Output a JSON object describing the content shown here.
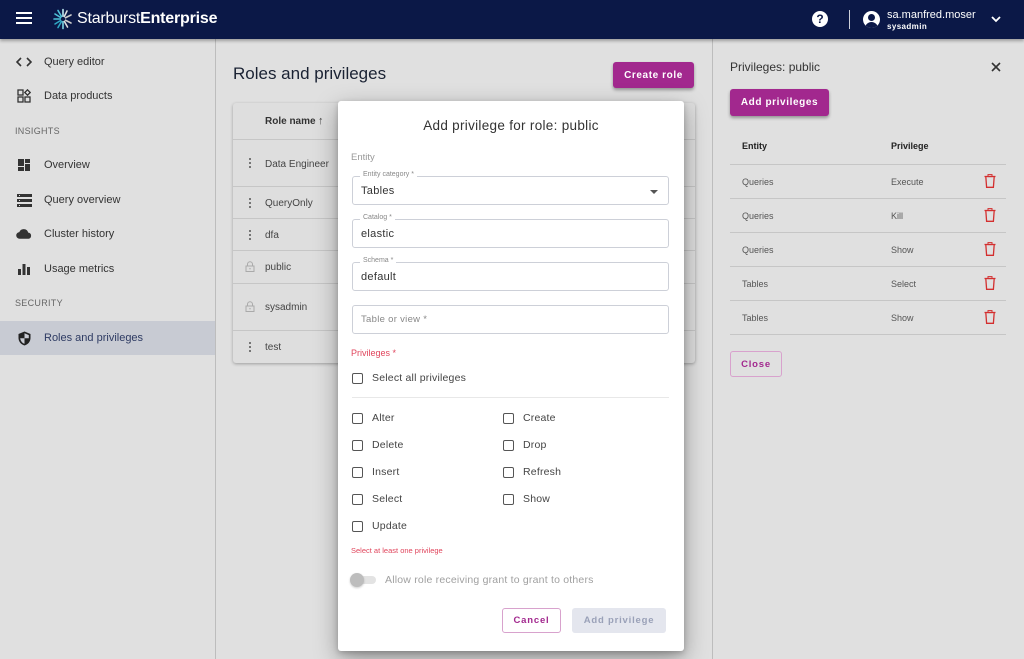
{
  "header": {
    "brand_light": "Starburst",
    "brand_bold": "Enterprise",
    "help_label": "?",
    "user_name": "sa.manfred.moser",
    "user_role": "sysadmin"
  },
  "sidebar": {
    "items": [
      {
        "label": "Query editor",
        "icon": "code-icon"
      },
      {
        "label": "Data products",
        "icon": "data-products-icon"
      },
      {
        "section": "INSIGHTS"
      },
      {
        "label": "Overview",
        "icon": "dashboard-icon"
      },
      {
        "label": "Query overview",
        "icon": "list-icon"
      },
      {
        "label": "Cluster history",
        "icon": "cloud-icon"
      },
      {
        "label": "Usage metrics",
        "icon": "bar-chart-icon"
      },
      {
        "section": "SECURITY"
      },
      {
        "label": "Roles and privileges",
        "icon": "shield-icon",
        "active": true
      }
    ]
  },
  "main": {
    "title": "Roles and privileges",
    "create_role_label": "Create role",
    "table": {
      "column_header": "Role name",
      "sort_indicator": "↑",
      "rows": [
        {
          "name": "Data Engineer",
          "icon": "kebab"
        },
        {
          "name": "QueryOnly",
          "icon": "kebab"
        },
        {
          "name": "dfa",
          "icon": "kebab"
        },
        {
          "name": "public",
          "icon": "lock"
        },
        {
          "name": "sysadmin",
          "icon": "lock"
        },
        {
          "name": "test",
          "icon": "kebab"
        }
      ]
    }
  },
  "right_panel": {
    "title": "Privileges: public",
    "add_button_label": "Add privileges",
    "columns": [
      "Entity",
      "Privilege"
    ],
    "rows": [
      {
        "entity": "Queries",
        "privilege": "Execute"
      },
      {
        "entity": "Queries",
        "privilege": "Kill"
      },
      {
        "entity": "Queries",
        "privilege": "Show"
      },
      {
        "entity": "Tables",
        "privilege": "Select"
      },
      {
        "entity": "Tables",
        "privilege": "Show"
      }
    ],
    "close_label": "Close"
  },
  "dialog": {
    "title": "Add privilege for role: public",
    "entity_section": "Entity",
    "entity_category": {
      "label": "Entity category *",
      "value": "Tables"
    },
    "catalog": {
      "label": "Catalog *",
      "value": "elastic"
    },
    "schema": {
      "label": "Schema *",
      "value": "default"
    },
    "table_or_view": {
      "placeholder": "Table or view *",
      "value": ""
    },
    "privileges_label": "Privileges *",
    "select_all_label": "Select all privileges",
    "privileges": [
      {
        "label": "Alter",
        "checked": false
      },
      {
        "label": "Create",
        "checked": false
      },
      {
        "label": "Delete",
        "checked": false
      },
      {
        "label": "Drop",
        "checked": false
      },
      {
        "label": "Insert",
        "checked": false
      },
      {
        "label": "Refresh",
        "checked": false
      },
      {
        "label": "Select",
        "checked": false
      },
      {
        "label": "Show",
        "checked": false
      },
      {
        "label": "Update",
        "checked": false
      }
    ],
    "error_text": "Select at least one privilege",
    "grant_toggle_label": "Allow role receiving grant to grant to others",
    "grant_toggle_on": false,
    "cancel_label": "Cancel",
    "submit_label": "Add privilege"
  },
  "colors": {
    "topbar": "#0b1847",
    "accent": "#a2288e",
    "error": "#e0455c",
    "delete_icon": "#d32f2f"
  }
}
